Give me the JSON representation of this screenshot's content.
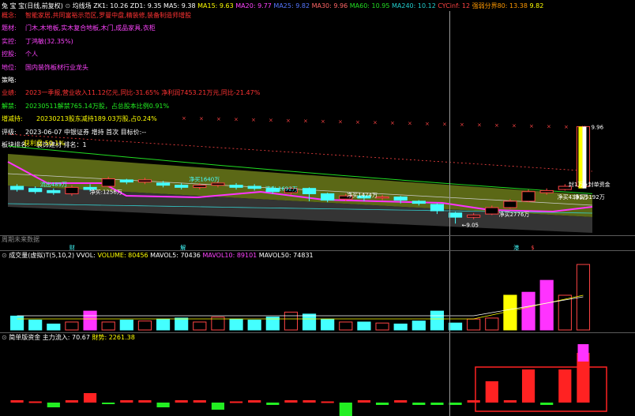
{
  "header": {
    "title": "兔 宝 宝(日线,前复权)",
    "indicator": "均线场",
    "items": [
      {
        "text": "ZK1: 10.26",
        "color": "#ffffff"
      },
      {
        "text": "ZD1: 9.35",
        "color": "#ffffff"
      },
      {
        "text": "MA5: 9.38",
        "color": "#ffffff"
      },
      {
        "text": "MA15: 9.63",
        "color": "#ffff00"
      },
      {
        "text": "MA20: 9.77",
        "color": "#ff44ff"
      },
      {
        "text": "MA25: 9.82",
        "color": "#5577ff"
      },
      {
        "text": "MA30: 9.96",
        "color": "#ff6666"
      },
      {
        "text": "MA60: 10.95",
        "color": "#22dd22"
      },
      {
        "text": "MA240: 10.12",
        "color": "#22cccc"
      },
      {
        "text": "CYCinf: 12",
        "color": "#ff4444"
      },
      {
        "text": "强弱分界80: 13.38",
        "color": "#ff9900"
      },
      {
        "text": "9.82",
        "color": "#ffff00"
      }
    ]
  },
  "info": [
    {
      "label": "概念:",
      "label_color": "#ff3333",
      "value": "智能家居,共同富裕示范区,罗曼中盘,精装修,装备制造师增股",
      "value_color": "#ff3333"
    },
    {
      "label": "题材:",
      "label_color": "#ff44ff",
      "value": "门木,木地板,实木复合地板,木门,成品家具,衣柜",
      "value_color": "#ff44ff"
    },
    {
      "label": "实控:",
      "label_color": "#ff44ff",
      "value": "丁鸿敏(32.35%)",
      "value_color": "#ff44ff"
    },
    {
      "label": "控股:",
      "label_color": "#ff44ff",
      "value": "个人",
      "value_color": "#ff44ff"
    },
    {
      "label": "地位:",
      "label_color": "#ff44ff",
      "value": "国内装饰板材行业龙头",
      "value_color": "#ff44ff"
    },
    {
      "label": "策略:",
      "label_color": "#ffffff",
      "value": "",
      "value_color": "#ffffff"
    },
    {
      "label": "业绩:",
      "label_color": "#ff3333",
      "value": "2023一季报,营业收入11.12亿元,同比-31.65% 净利润7453.21万元,同比-21.47%",
      "value_color": "#ff3333"
    },
    {
      "label": "解禁:",
      "label_color": "#22ee22",
      "value": "20230511解禁765.14万股，占总股本比例0.91%",
      "value_color": "#22ee22"
    },
    {
      "label": "增减持:",
      "label_color": "#ffff00",
      "value": "20230213股东减持189.03万股,占0.24%",
      "value_color": "#ffff00"
    },
    {
      "label": "评级:",
      "label_color": "#ffffff",
      "value": "2023-06-07 中银证券 增持 首次 目标价:--",
      "value_color": "#ffffff"
    },
    {
      "label": "板块排名:",
      "label_color": "#ffffff",
      "value": "装饰建材     排名：1",
      "value_color": "#ffffff"
    }
  ],
  "profit": {
    "text": "获利盘:50.1%",
    "color": "#ffff00"
  },
  "price_labels": {
    "high_value": "9.96",
    "low_value": "9.05",
    "future_label": "周期未来数据"
  },
  "chart_annotations": [
    {
      "text": "流出489万",
      "color": "#44ffff",
      "x": 0.055,
      "price": 9.4
    },
    {
      "text": "净买:1256万",
      "color": "#ffffff",
      "x": 0.14,
      "price": 9.33
    },
    {
      "text": "净买1640万",
      "color": "#44ffff",
      "x": 0.31,
      "price": 9.45
    },
    {
      "text": "流出:1692万",
      "color": "#44ffff",
      "x": 0.44,
      "price": 9.36
    },
    {
      "text": "净买1474万",
      "color": "#ffffff",
      "x": 0.58,
      "price": 9.3
    },
    {
      "text": "净买2776万",
      "color": "#ffffff",
      "x": 0.84,
      "price": 9.12
    },
    {
      "text": "净买4331万",
      "color": "#ffffff",
      "x": 0.94,
      "price": 9.28
    },
    {
      "text": "净买5192万",
      "color": "#ffffff",
      "x": 0.995,
      "price": 9.28
    },
    {
      "text": "封1万★封单资金",
      "color": "#ffffff",
      "x": 0.995,
      "price": 9.4
    }
  ],
  "markers": [
    {
      "text": "财",
      "color": "#44ffff",
      "x_frac": 0.105
    },
    {
      "text": "解",
      "color": "#44ffff",
      "x_frac": 0.295
    },
    {
      "text": "港",
      "color": "#44ffff",
      "x_frac": 0.865
    },
    {
      "text": "$",
      "color": "#ff4444",
      "x_frac": 0.895
    }
  ],
  "volume_panel": {
    "title": "成交量(虚拟)T(5,10,2)",
    "indicator": "VVOL:",
    "items": [
      {
        "text": "VOLUME: 80456",
        "color": "#ffff00"
      },
      {
        "text": "MAVOL5: 70436",
        "color": "#ffffff"
      },
      {
        "text": "MAVOL10: 89101",
        "color": "#ff44ff"
      },
      {
        "text": "MAVOL50: 74831",
        "color": "#ffffff"
      }
    ]
  },
  "fund_panel": {
    "title": "简单版资金",
    "items": [
      {
        "text": "主力流入: 70.67",
        "color": "#ffffff"
      },
      {
        "text": "財势: 2261.38",
        "color": "#ffff00"
      }
    ]
  },
  "chart_data": {
    "type": "bar",
    "price_range": [
      9.0,
      10.0
    ],
    "candles": [
      {
        "o": 9.4,
        "c": 9.37,
        "h": 9.42,
        "l": 9.35
      },
      {
        "o": 9.38,
        "c": 9.35,
        "h": 9.4,
        "l": 9.33
      },
      {
        "o": 9.36,
        "c": 9.34,
        "h": 9.38,
        "l": 9.32
      },
      {
        "o": 9.33,
        "c": 9.39,
        "h": 9.41,
        "l": 9.31
      },
      {
        "o": 9.39,
        "c": 9.37,
        "h": 9.42,
        "l": 9.35
      },
      {
        "o": 9.4,
        "c": 9.47,
        "h": 9.49,
        "l": 9.39
      },
      {
        "o": 9.46,
        "c": 9.44,
        "h": 9.47,
        "l": 9.42
      },
      {
        "o": 9.44,
        "c": 9.46,
        "h": 9.48,
        "l": 9.42
      },
      {
        "o": 9.43,
        "c": 9.41,
        "h": 9.45,
        "l": 9.39
      },
      {
        "o": 9.41,
        "c": 9.39,
        "h": 9.43,
        "l": 9.37
      },
      {
        "o": 9.39,
        "c": 9.41,
        "h": 9.43,
        "l": 9.37
      },
      {
        "o": 9.41,
        "c": 9.43,
        "h": 9.45,
        "l": 9.39
      },
      {
        "o": 9.41,
        "c": 9.39,
        "h": 9.43,
        "l": 9.37
      },
      {
        "o": 9.4,
        "c": 9.38,
        "h": 9.42,
        "l": 9.36
      },
      {
        "o": 9.38,
        "c": 9.35,
        "h": 9.4,
        "l": 9.33
      },
      {
        "o": 9.34,
        "c": 9.38,
        "h": 9.4,
        "l": 9.32
      },
      {
        "o": 9.38,
        "c": 9.33,
        "h": 9.39,
        "l": 9.26
      },
      {
        "o": 9.33,
        "c": 9.27,
        "h": 9.34,
        "l": 9.25
      },
      {
        "o": 9.28,
        "c": 9.31,
        "h": 9.33,
        "l": 9.26
      },
      {
        "o": 9.31,
        "c": 9.29,
        "h": 9.33,
        "l": 9.26
      },
      {
        "o": 9.29,
        "c": 9.3,
        "h": 9.32,
        "l": 9.27
      },
      {
        "o": 9.3,
        "c": 9.27,
        "h": 9.31,
        "l": 9.24
      },
      {
        "o": 9.26,
        "c": 9.24,
        "h": 9.27,
        "l": 9.22
      },
      {
        "o": 9.23,
        "c": 9.17,
        "h": 9.24,
        "l": 9.14
      },
      {
        "o": 9.15,
        "c": 9.11,
        "h": 9.16,
        "l": 9.05
      },
      {
        "o": 9.11,
        "c": 9.13,
        "h": 9.15,
        "l": 9.09
      },
      {
        "o": 9.14,
        "c": 9.2,
        "h": 9.22,
        "l": 9.13
      },
      {
        "o": 9.2,
        "c": 9.26,
        "h": 9.28,
        "l": 9.19
      },
      {
        "o": 9.26,
        "c": 9.35,
        "h": 9.37,
        "l": 9.25
      },
      {
        "o": 9.34,
        "c": 9.36,
        "h": 9.38,
        "l": 9.32
      },
      {
        "o": 9.37,
        "c": 9.4,
        "h": 9.42,
        "l": 9.36
      },
      {
        "o": 9.4,
        "c": 9.96,
        "h": 9.96,
        "l": 9.38
      }
    ],
    "volumes": [
      14,
      10,
      6,
      8,
      19,
      8,
      10,
      9,
      11,
      12,
      8,
      13,
      11,
      10,
      13,
      18,
      16,
      11,
      8,
      8,
      7,
      6,
      9,
      19,
      7,
      11,
      12,
      35,
      38,
      50,
      35,
      66
    ],
    "fund": [
      1,
      0.5,
      -2,
      1,
      4,
      -0.5,
      1,
      1,
      -2,
      1,
      1,
      -3,
      0.5,
      1,
      -1,
      1,
      1,
      0.5,
      -6,
      1,
      -1,
      1,
      -1,
      -1,
      -1,
      1,
      9,
      1,
      14,
      -1,
      14,
      21
    ]
  }
}
